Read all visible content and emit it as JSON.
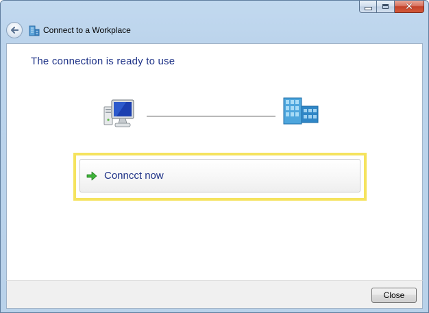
{
  "window": {
    "title": "Connect to a Workplace",
    "controls": {
      "minimize_icon": "minimize-icon",
      "maximize_icon": "maximize-icon",
      "close_icon": "close-icon"
    }
  },
  "nav": {
    "back_icon": "back-arrow-icon",
    "title_icon": "workplace-building-icon"
  },
  "main": {
    "heading": "The connection is ready to use",
    "diagram": {
      "left_icon": "computer-icon",
      "right_icon": "workplace-building-icon"
    },
    "connect_option": {
      "label": "Conncct now",
      "icon": "green-arrow-icon"
    }
  },
  "footer": {
    "close_label": "Close"
  },
  "colors": {
    "heading_text": "#1e3287",
    "highlight_border": "#f5e35e",
    "window_frame": "#bcd4ec"
  }
}
